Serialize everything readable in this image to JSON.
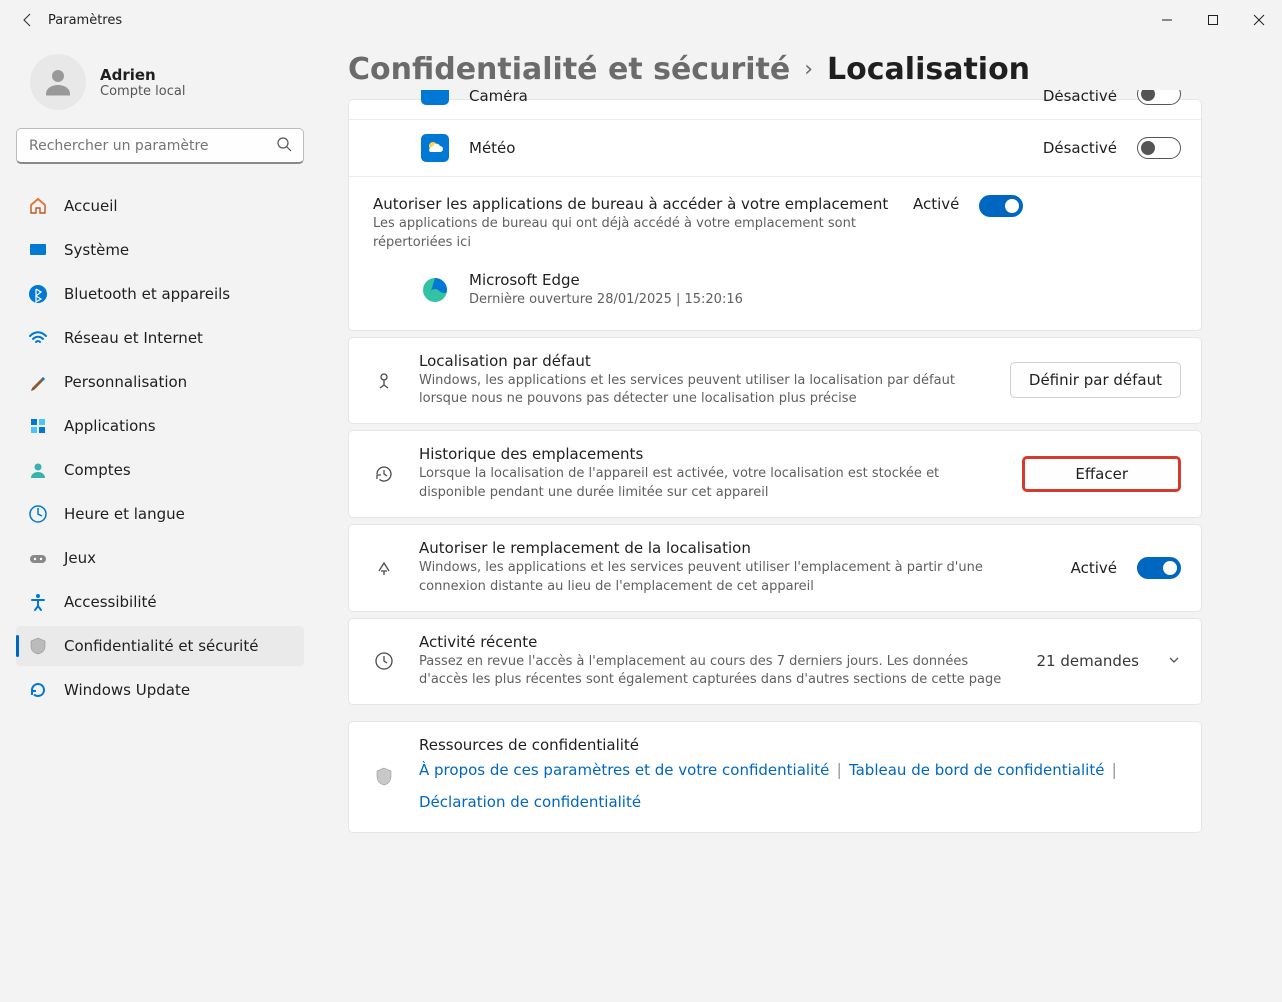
{
  "window": {
    "title": "Paramètres"
  },
  "user": {
    "name": "Adrien",
    "account_type": "Compte local"
  },
  "search": {
    "placeholder": "Rechercher un paramètre"
  },
  "nav": {
    "items": [
      {
        "label": "Accueil"
      },
      {
        "label": "Système"
      },
      {
        "label": "Bluetooth et appareils"
      },
      {
        "label": "Réseau et Internet"
      },
      {
        "label": "Personnalisation"
      },
      {
        "label": "Applications"
      },
      {
        "label": "Comptes"
      },
      {
        "label": "Heure et langue"
      },
      {
        "label": "Jeux"
      },
      {
        "label": "Accessibilité"
      },
      {
        "label": "Confidentialité et sécurité"
      },
      {
        "label": "Windows Update"
      }
    ]
  },
  "breadcrumb": {
    "parent": "Confidentialité et sécurité",
    "current": "Localisation"
  },
  "apps": {
    "camera": {
      "name": "Caméra",
      "state": "Désactivé"
    },
    "weather": {
      "name": "Météo",
      "state": "Désactivé"
    }
  },
  "desktop_apps": {
    "title": "Autoriser les applications de bureau à accéder à votre emplacement",
    "subtitle": "Les applications de bureau qui ont déjà accédé à votre emplacement sont répertoriées ici",
    "state": "Activé",
    "edge": {
      "name": "Microsoft Edge",
      "detail": "Dernière ouverture 28/01/2025  |  15:20:16"
    }
  },
  "default_loc": {
    "title": "Localisation par défaut",
    "subtitle": "Windows, les applications et les services peuvent utiliser la localisation par défaut lorsque nous ne pouvons pas détecter une localisation plus précise",
    "button": "Définir par défaut"
  },
  "history": {
    "title": "Historique des emplacements",
    "subtitle": "Lorsque la localisation de l'appareil est activée, votre localisation est stockée et disponible pendant une durée limitée sur cet appareil",
    "button": "Effacer"
  },
  "override": {
    "title": "Autoriser le remplacement de la localisation",
    "subtitle": "Windows, les applications et les services peuvent utiliser l'emplacement à partir d'une connexion distante au lieu de l'emplacement de cet appareil",
    "state": "Activé"
  },
  "recent": {
    "title": "Activité récente",
    "subtitle": "Passez en revue l'accès à l'emplacement au cours des 7 derniers jours. Les données d'accès les plus récentes sont également capturées dans d'autres sections de cette page",
    "count": "21 demandes"
  },
  "resources": {
    "title": "Ressources de confidentialité",
    "link1": "À propos de ces paramètres et de votre confidentialité",
    "link2": "Tableau de bord de confidentialité",
    "link3": "Déclaration de confidentialité"
  }
}
